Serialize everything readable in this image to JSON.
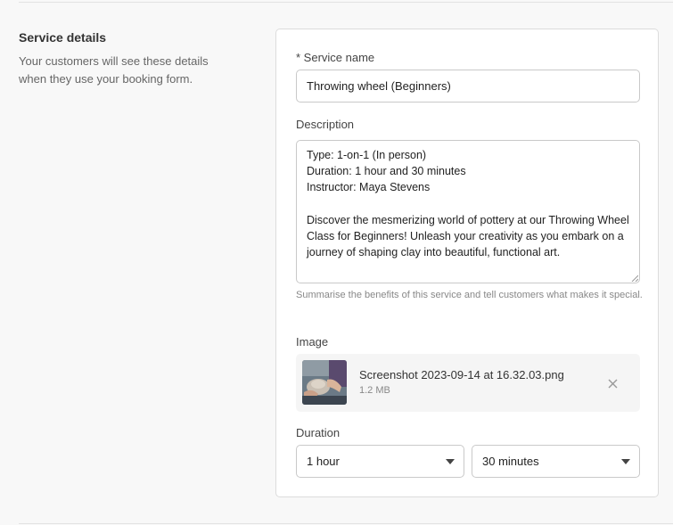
{
  "section": {
    "title": "Service details",
    "description": "Your customers will see these details when they use your booking form."
  },
  "service_name": {
    "label": "* Service name",
    "value": "Throwing wheel (Beginners)"
  },
  "description_field": {
    "label": "Description",
    "value": "Type: 1-on-1 (In person)\nDuration: 1 hour and 30 minutes\nInstructor: Maya Stevens\n\nDiscover the mesmerizing world of pottery at our Throwing Wheel Class for Beginners! Unleash your creativity as you embark on a journey of shaping clay into beautiful, functional art.",
    "helper": "Summarise the benefits of this service and tell customers what makes it special."
  },
  "image": {
    "label": "Image",
    "file_name": "Screenshot 2023-09-14 at 16.32.03.png",
    "file_size": "1.2 MB",
    "remove_icon": "close-icon"
  },
  "duration": {
    "label": "Duration",
    "hours_value": "1 hour",
    "minutes_value": "30 minutes",
    "caret_icon": "caret-down-icon"
  },
  "colors": {
    "background": "#f8f8f8",
    "card": "#ffffff",
    "border": "#c9c9c9",
    "text": "#333333",
    "muted": "#888888"
  }
}
